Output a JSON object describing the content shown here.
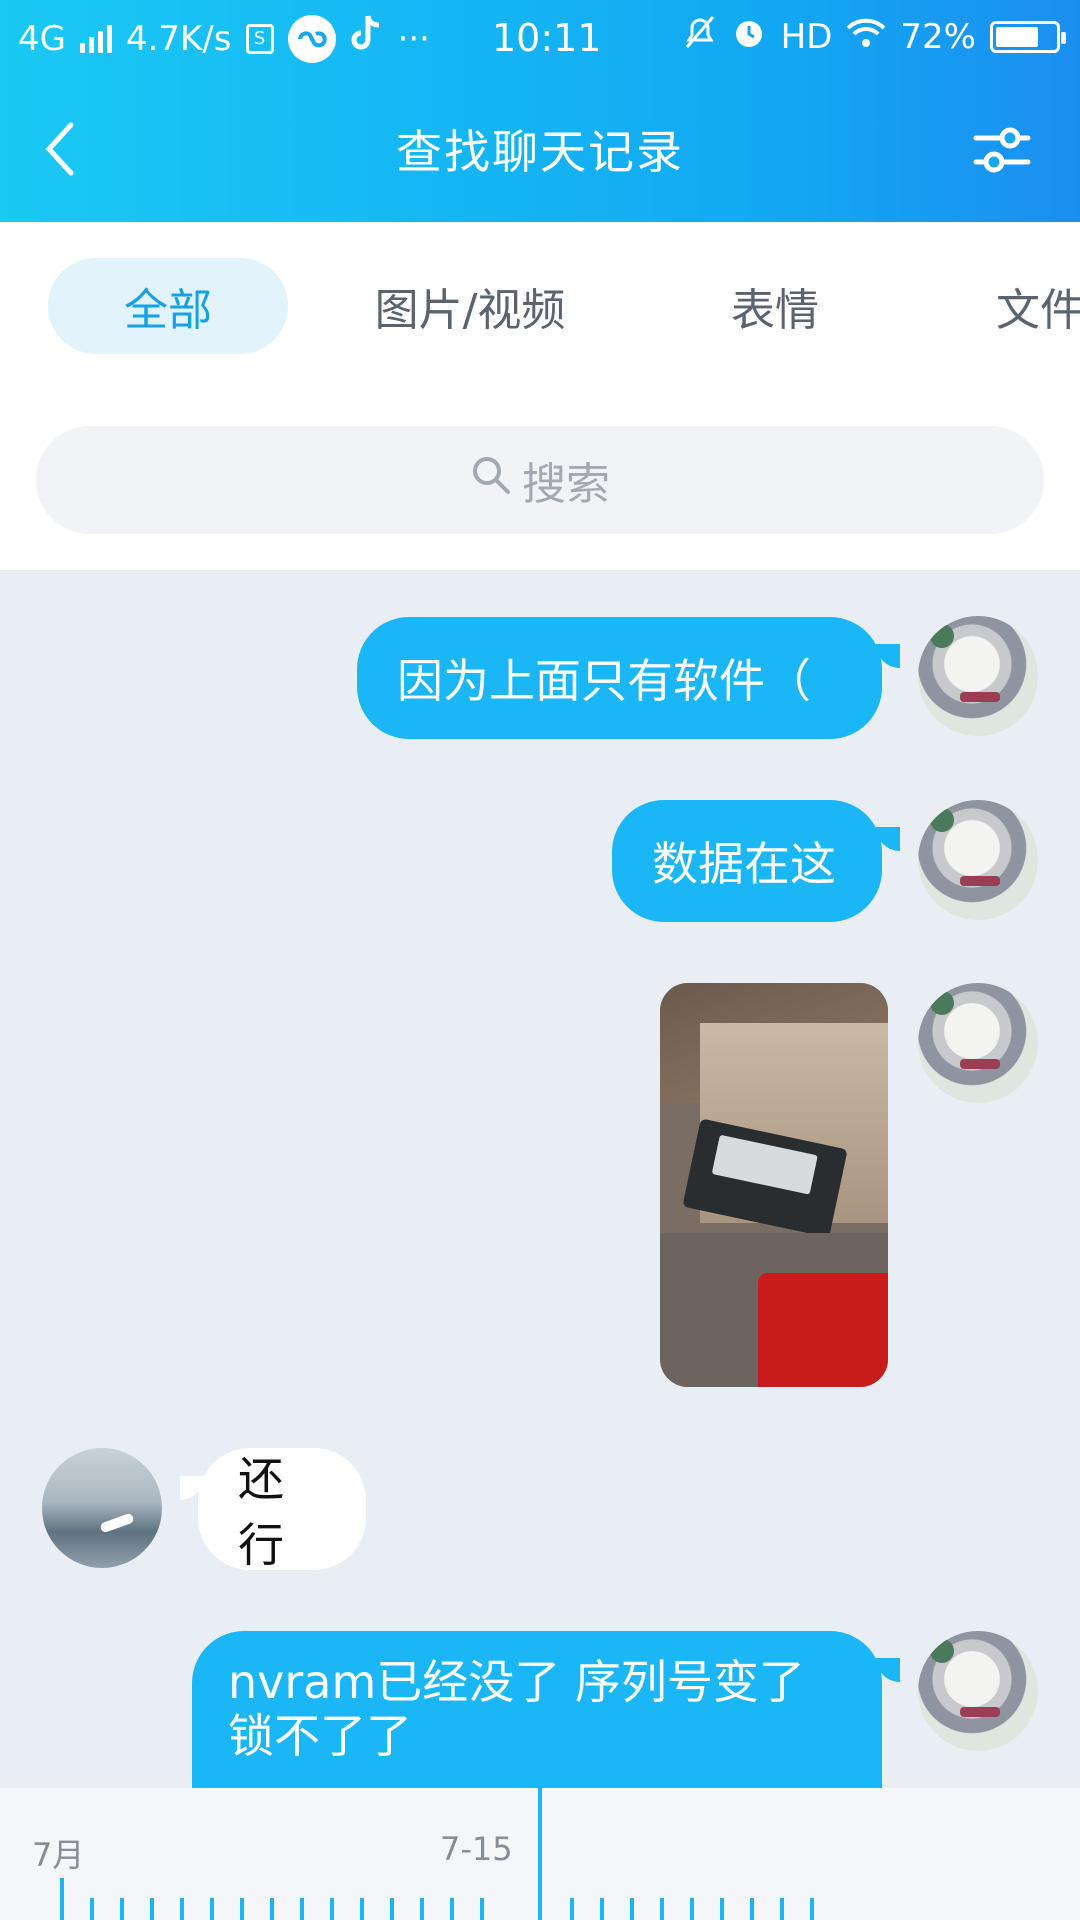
{
  "status_bar": {
    "network": "4G",
    "speed": "4.7K/s",
    "sim_badge": "S",
    "overflow": "···",
    "time": "10:11",
    "hd": "HD",
    "battery_percent": "72%",
    "battery_level": 0.72,
    "icons": [
      "signal-icon",
      "sim-icon",
      "app-icon",
      "tiktok-icon",
      "silent-icon",
      "alarm-icon",
      "wifi-icon",
      "battery-icon"
    ]
  },
  "header": {
    "title": "查找聊天记录",
    "back_icon": "chevron-left-icon",
    "filter_icon": "sliders-icon"
  },
  "tabs": [
    {
      "label": "全部",
      "active": true
    },
    {
      "label": "图片/视频",
      "active": false
    },
    {
      "label": "表情",
      "active": false
    },
    {
      "label": "文件",
      "active": false
    }
  ],
  "search": {
    "placeholder": "搜索",
    "icon": "search-icon"
  },
  "messages": [
    {
      "side": "me",
      "type": "text",
      "text": "因为上面只有软件（"
    },
    {
      "side": "me",
      "type": "text",
      "text": "数据在这"
    },
    {
      "side": "me",
      "type": "image",
      "alt": "photo of hard drive in drawer"
    },
    {
      "side": "other",
      "type": "text",
      "text": "还行"
    },
    {
      "side": "me",
      "type": "text",
      "text": "nvram已经没了 序列号变了 锁不了了"
    }
  ],
  "timeline": {
    "month_label": "7月",
    "date_label": "7-15"
  },
  "colors": {
    "accent": "#1ab6f5",
    "header_start": "#1ac9f4",
    "header_end": "#1b8ff0",
    "chat_bg": "#e9edf4"
  }
}
